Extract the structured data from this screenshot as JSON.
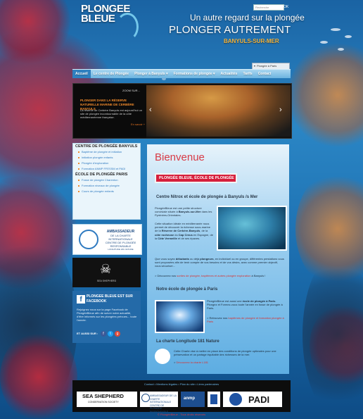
{
  "header": {
    "logo_line1": "PLONGEE",
    "logo_line2": "BLEUE",
    "search_placeholder": "Recherche",
    "search_button": "OK",
    "tagline": "Un autre regard sur la plongée",
    "brand": "PLONGER AUTREMENT",
    "location": "BANYULS-SUR-MER",
    "lang_select": "Plongée à Paris"
  },
  "nav": {
    "items": [
      {
        "label": "Accueil"
      },
      {
        "label": "Le centre de Plongée"
      },
      {
        "label": "Plonger à Banyuls ▾"
      },
      {
        "label": "Formations de plongée ▾"
      },
      {
        "label": "Actualités"
      },
      {
        "label": "Tarifs"
      },
      {
        "label": "Contact"
      }
    ]
  },
  "slider": {
    "zoom_label": "ZOOM SUR...",
    "headline": "PLONGER DANS LA RÉSERVE NATURELLE MARINE DE CERBÈRE BANYULS",
    "body": "La réserve de Cerbère Banyuls est aujourd'hui un site de plongée incontournable de la côte méditerranéenne française.",
    "more": "En savoir +",
    "prev": "‹",
    "next": "›"
  },
  "sidebar": {
    "section1_title": "CENTRE DE PLONGÉE BANYULS",
    "section1_links": [
      "Baptême de plongée et initiation",
      "Initiation plongée enfants",
      "Plongée d'exploration",
      "Formation ANMP FFESSM et PADI"
    ],
    "section2_title": "ÉCOLE DE PLONGÉE PARIS",
    "section2_links": [
      "Fosse de plongée Charenton",
      "Formation niveaux de plongée",
      "Cours de plongée enfants"
    ],
    "ambassador_line1": "AMBASSADEUR",
    "ambassador_line2": "DE LA CHARTE INTERNATIONALE",
    "ambassador_line3": "CENTRE DE PLONGÉE RESPONSABLE",
    "ambassador_brand": "LONGITUDE 181 NATURE",
    "shepherd_text": "SEA SHEPHERD",
    "fb_title": "PLONGEE BLEUE EST SUR FACEBOOK",
    "fb_text": "Rejoignez nous sur la page Facebook de PlongéeBleue afin de suivre notre actualité, d'être informés sur les plongées prévues... toute l'année.",
    "follow": "ET AUSSI SUR :",
    "social": [
      "f",
      "t",
      "g"
    ]
  },
  "main": {
    "welcome": "Bienvenue",
    "school_bar": "PLONGÉE BLEUE, ÉCOLE DE PLONGÉE",
    "h_banyuls": "Centre Nitrox et école de plongée à Banyuls /s Mer",
    "p1a": "PlongéeBleue est une petite structure conviviale située à ",
    "p1b": "Banyuls-sur-Mer",
    "p1c": " dans les Pyrénées-Orientales.",
    "p2a": "Cette situation idéale en méditerranée nous permet de découvrir la richesse sous-marine de la ",
    "p2b": "Réserve de Cerbère-Banyuls",
    "p2c": ", de la ",
    "p2d": "côte rocheuse",
    "p2e": " du ",
    "p2f": "Cap Creus",
    "p2g": " en Espagne, de la ",
    "p2h": "Côte Vermeille",
    "p2i": " et de ses épaves.",
    "p3a": "Que vous soyez ",
    "p3b": "débutants",
    "p3c": " ou déjà ",
    "p3d": "plongeurs",
    "p3e": ", en individuel ou en groupe, différentes prestations vous sont proposées afin de tenir compte de vos besoins et de vos désirs, avec comme premier objectif, vous sécuriser...",
    "p4a": "> Découvrez nos ",
    "p4b": "sorties de plongée, baptêmes et autres plongée exploration",
    "p4c": " à Banyuls !",
    "h_paris": "Notre école de plongée à Paris",
    "pp1a": "PlongéeBleue est aussi une ",
    "pp1b": "école de plongée à Paris",
    "pp1c": ". Plongez et Formez-vous toute l'année en fosse de plongée à Paris.",
    "pp2a": "> Retrouvez nos ",
    "pp2b": "baptêmes de plongée et formation plongée à Paris",
    "h_charte": "La charte Longitude 181 Nature",
    "pc1": "Cette Charte vise à mettre en place des conditions de plongée optimales pour une préservation et un partage équitable des richesses de la mer.",
    "pc2a": "> ",
    "pc2b": "Découvrez la charte L181"
  },
  "footer": {
    "links": "Contact • Mentions légales • Plan du site • Liens partenaires",
    "logo1_line1": "SEA SHEPHERD",
    "logo1_line2": "CONSERVATION SOCIETY",
    "logo2": "AMBASSADEUR DE LA CHARTE INTERNATIONALE CENTRE DE PLONGÉE RESPONSABLE",
    "logo3": "anmp",
    "logo5": "PADI",
    "copyright": "© PlongéeBleue - Tous droits réservés"
  }
}
